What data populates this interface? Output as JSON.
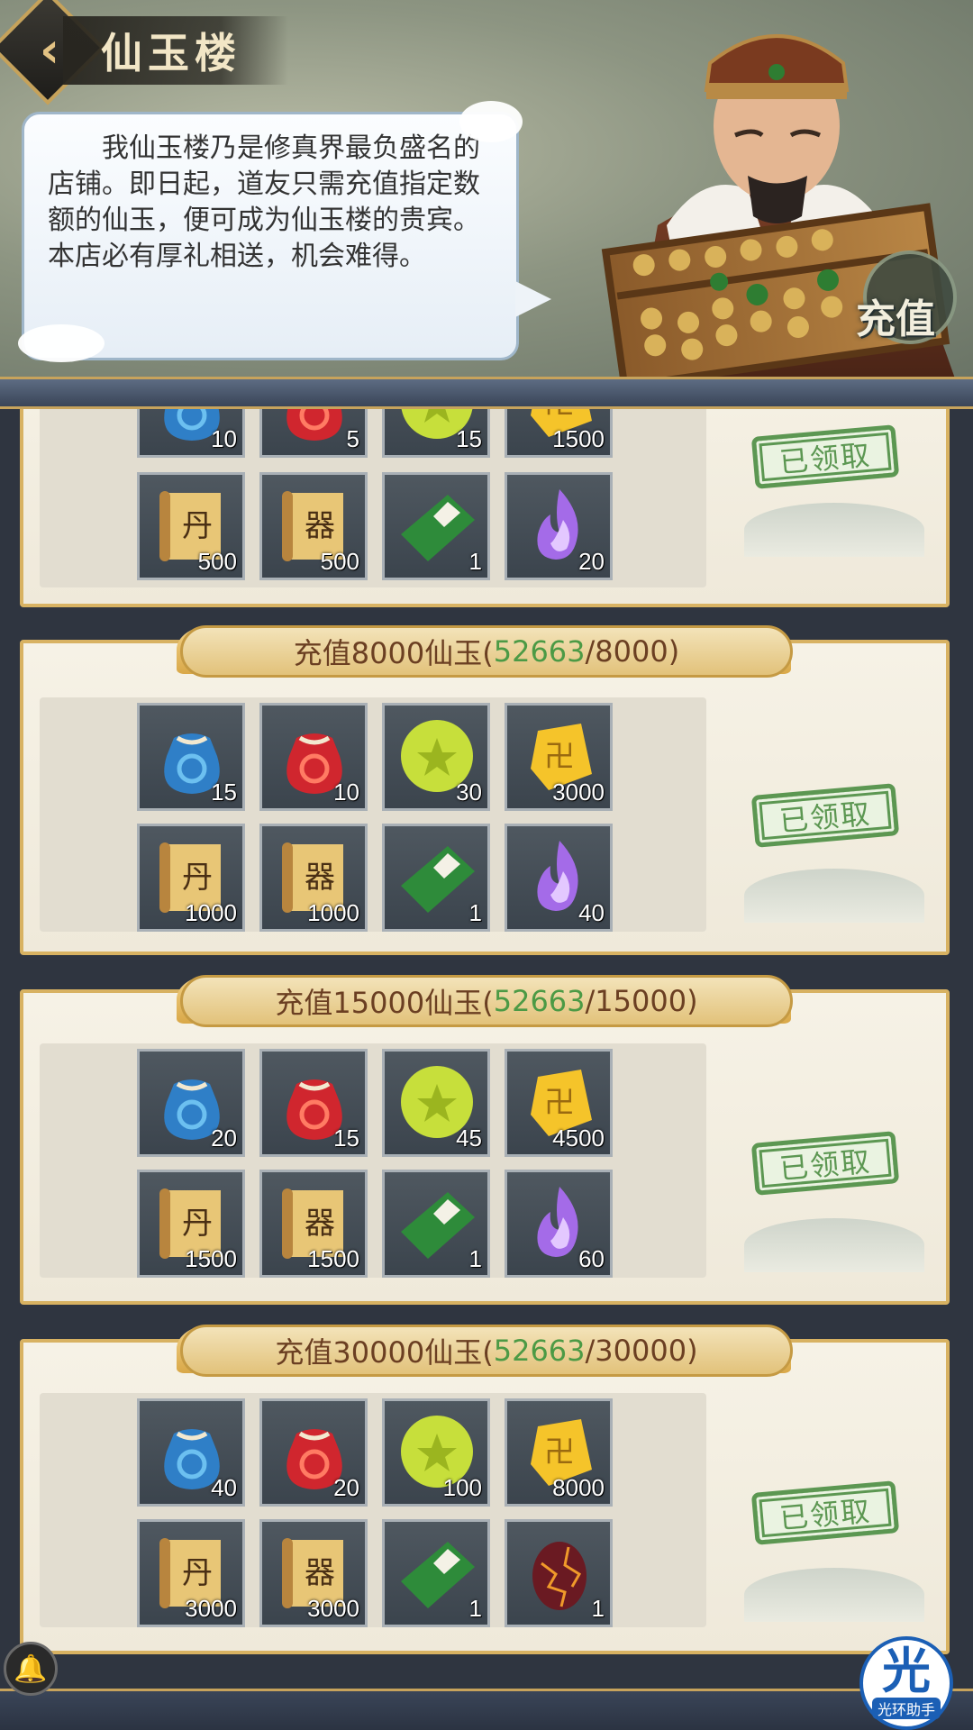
{
  "header": {
    "title": "仙玉楼",
    "back_icon": "chevron-left-icon",
    "recharge_label": "充值"
  },
  "speech": {
    "text": "我仙玉楼乃是修真界最负盛名的店铺。即日起，道友只需充值指定数额的仙玉，便可成为仙玉楼的贵宾。本店必有厚礼相送，机会难得。"
  },
  "tiers": [
    {
      "label_prefix": "",
      "current": "",
      "target": "",
      "status": "已领取",
      "items": [
        {
          "icon": "blue-pouch-icon",
          "qty": "10"
        },
        {
          "icon": "red-pouch-icon",
          "qty": "5"
        },
        {
          "icon": "green-orb-icon",
          "qty": "15"
        },
        {
          "icon": "gold-ingot-icon",
          "qty": "1500"
        },
        {
          "icon": "dan-scroll-icon",
          "qty": "500"
        },
        {
          "icon": "qi-scroll-icon",
          "qty": "500"
        },
        {
          "icon": "green-book-icon",
          "qty": "1"
        },
        {
          "icon": "purple-flame-icon",
          "qty": "20"
        }
      ]
    },
    {
      "label_prefix": "充值8000仙玉(",
      "current": "52663",
      "target": "/8000)",
      "status": "已领取",
      "items": [
        {
          "icon": "blue-pouch-icon",
          "qty": "15"
        },
        {
          "icon": "red-pouch-icon",
          "qty": "10"
        },
        {
          "icon": "green-orb-icon",
          "qty": "30"
        },
        {
          "icon": "gold-ingot-icon",
          "qty": "3000"
        },
        {
          "icon": "dan-scroll-icon",
          "qty": "1000"
        },
        {
          "icon": "qi-scroll-icon",
          "qty": "1000"
        },
        {
          "icon": "green-book-icon",
          "qty": "1"
        },
        {
          "icon": "purple-flame-icon",
          "qty": "40"
        }
      ]
    },
    {
      "label_prefix": "充值15000仙玉(",
      "current": "52663",
      "target": "/15000)",
      "status": "已领取",
      "items": [
        {
          "icon": "blue-pouch-icon",
          "qty": "20"
        },
        {
          "icon": "red-pouch-icon",
          "qty": "15"
        },
        {
          "icon": "green-orb-icon",
          "qty": "45"
        },
        {
          "icon": "gold-ingot-icon",
          "qty": "4500"
        },
        {
          "icon": "dan-scroll-icon",
          "qty": "1500"
        },
        {
          "icon": "qi-scroll-icon",
          "qty": "1500"
        },
        {
          "icon": "green-book-icon",
          "qty": "1"
        },
        {
          "icon": "purple-flame-icon",
          "qty": "60"
        }
      ]
    },
    {
      "label_prefix": "充值30000仙玉(",
      "current": "52663",
      "target": "/30000)",
      "status": "已领取",
      "items": [
        {
          "icon": "blue-pouch-icon",
          "qty": "40"
        },
        {
          "icon": "red-pouch-icon",
          "qty": "20"
        },
        {
          "icon": "green-orb-icon",
          "qty": "100"
        },
        {
          "icon": "gold-ingot-icon",
          "qty": "8000"
        },
        {
          "icon": "dan-scroll-icon",
          "qty": "3000"
        },
        {
          "icon": "qi-scroll-icon",
          "qty": "3000"
        },
        {
          "icon": "green-book-icon",
          "qty": "1"
        },
        {
          "icon": "magma-egg-icon",
          "qty": "1"
        }
      ]
    }
  ],
  "overlay": {
    "bell_icon": "bell-icon",
    "helper_glyph": "光",
    "helper_label": "光环助手"
  },
  "colors": {
    "progress_current": "#4c9a45",
    "claimed_green": "#5c9752",
    "frame_gold": "#d8b262"
  }
}
